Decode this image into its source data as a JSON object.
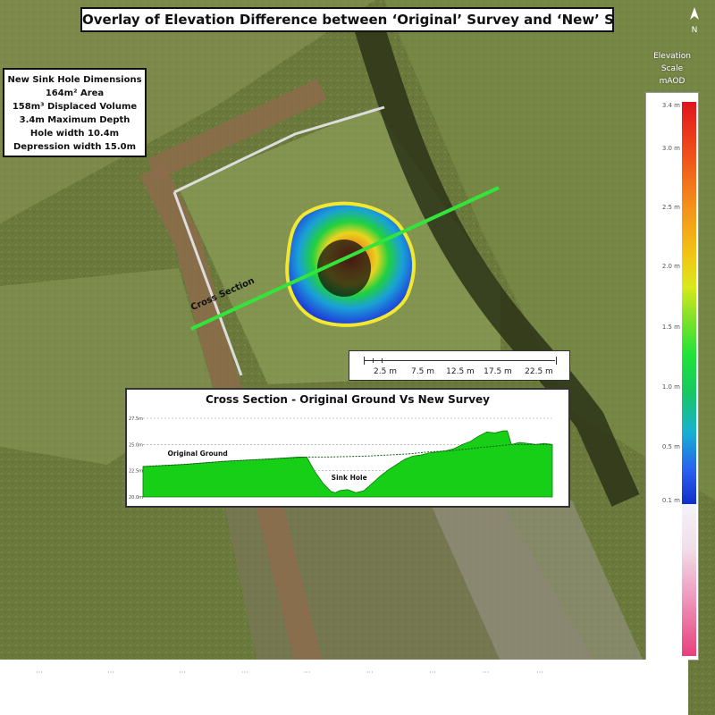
{
  "title": "Overlay of Elevation Difference between ‘Original’ Survey and ‘New’ Survey",
  "north_label": "N",
  "north_arrow_icon": "north-arrow-icon",
  "dimensions": {
    "heading": "New Sink Hole Dimensions",
    "lines": [
      "164m² Area",
      "158m³ Displaced Volume",
      "3.4m Maximum Depth",
      "Hole width 10.4m",
      "Depression width 15.0m"
    ]
  },
  "map_labels": {
    "cross_section": "Cross Section"
  },
  "elevation_scale": {
    "title_lines": [
      "Elevation",
      "Scale",
      "mAOD"
    ],
    "ticks": [
      {
        "label": "3.4 m",
        "value": 3.4
      },
      {
        "label": "3.0 m",
        "value": 3.0
      },
      {
        "label": "2.5 m",
        "value": 2.5
      },
      {
        "label": "2.0 m",
        "value": 2.0
      },
      {
        "label": "1.5 m",
        "value": 1.5
      },
      {
        "label": "1.0 m",
        "value": 1.0
      },
      {
        "label": "0.5 m",
        "value": 0.5
      },
      {
        "label": "0.1 m",
        "value": 0.1
      }
    ],
    "colors": [
      "#e0141e",
      "#f5901a",
      "#d8e81c",
      "#1fe33a",
      "#16b2d0",
      "#1030c8"
    ]
  },
  "scale_bar": {
    "labels": [
      "2.5 m",
      "7.5 m",
      "12.5 m",
      "17.5 m",
      "22.5 m"
    ]
  },
  "cross_section": {
    "title": "Cross Section - Original Ground Vs New Survey",
    "original_ground_label": "Original Ground",
    "sink_hole_label": "Sink Hole",
    "y_ticks": [
      "27.5m",
      "25.0m",
      "22.5m",
      "20.0m"
    ],
    "fill_color": "#17cf17"
  },
  "chart_data": {
    "type": "area",
    "title": "Cross Section - Original Ground Vs New Survey",
    "y_ticks": [
      27.5,
      25.0,
      22.5,
      20.0
    ],
    "ylim": [
      20.0,
      27.5
    ],
    "xlim": [
      0,
      100
    ],
    "series": [
      {
        "name": "Original Ground",
        "x": [
          0,
          10,
          20,
          30,
          40,
          45,
          50,
          55,
          60,
          65,
          70,
          75,
          80,
          82,
          85,
          90,
          95,
          100
        ],
        "values": [
          22.9,
          23.1,
          23.4,
          23.6,
          23.8,
          23.8,
          23.85,
          23.9,
          24.0,
          24.1,
          24.3,
          24.4,
          24.6,
          24.7,
          24.8,
          25.0,
          25.0,
          25.0
        ]
      },
      {
        "name": "New Survey",
        "x": [
          0,
          10,
          20,
          30,
          38,
          40,
          42,
          44,
          46,
          47,
          48,
          50,
          52,
          54,
          56,
          58,
          60,
          62,
          64,
          66,
          68,
          70,
          72,
          74,
          76,
          78,
          80,
          82,
          84,
          86,
          88,
          89,
          90,
          92,
          94,
          96,
          98,
          100
        ],
        "values": [
          22.9,
          23.1,
          23.4,
          23.6,
          23.8,
          23.8,
          22.4,
          21.3,
          20.5,
          20.4,
          20.6,
          20.7,
          20.4,
          20.6,
          21.3,
          22.0,
          22.6,
          23.1,
          23.6,
          23.9,
          24.0,
          24.2,
          24.3,
          24.4,
          24.6,
          25.0,
          25.3,
          25.8,
          26.2,
          26.1,
          26.3,
          26.3,
          25.0,
          25.2,
          25.1,
          25.0,
          25.1,
          25.0
        ]
      }
    ]
  }
}
